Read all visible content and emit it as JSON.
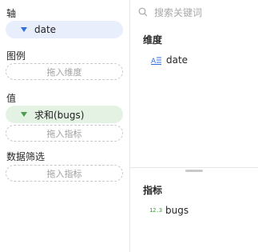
{
  "left_panel": {
    "axis": {
      "label": "轴",
      "field": "date"
    },
    "legend": {
      "label": "图例",
      "placeholder": "拖入维度"
    },
    "values": {
      "label": "值",
      "field": "求和(bugs)",
      "placeholder": "拖入指标"
    },
    "filter": {
      "label": "数据筛选",
      "placeholder": "拖入指标"
    }
  },
  "right_panel": {
    "search_placeholder": "搜索关键词",
    "dimensions": {
      "title": "维度",
      "items": [
        {
          "label": "date",
          "icon": "text-field-icon"
        }
      ]
    },
    "measures": {
      "title": "指标",
      "items": [
        {
          "label": "bugs",
          "icon_text": "12.3",
          "icon": "numeric-field-icon"
        }
      ]
    }
  },
  "colors": {
    "dimension_blue": "#2f6fe0",
    "measure_green": "#4a9d4a",
    "pill_blue_bg": "#e8eefc",
    "pill_green_bg": "#e4f2e4"
  }
}
